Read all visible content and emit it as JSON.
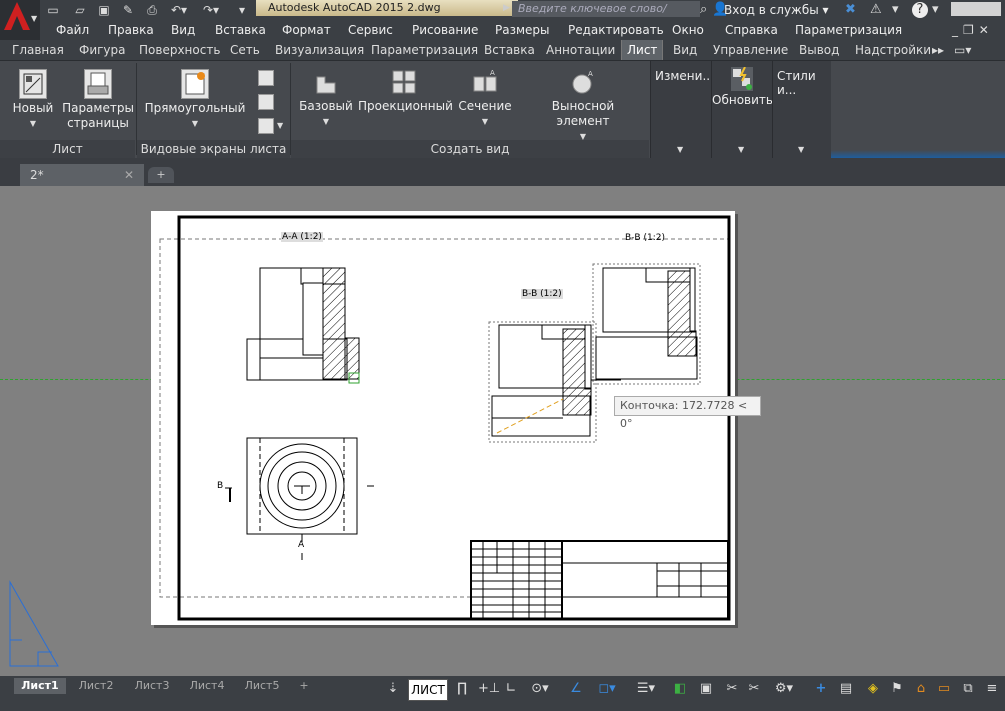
{
  "title_bar": {
    "app_title": "Autodesk AutoCAD 2015      2.dwg",
    "search_placeholder": "Введите ключевое слово/фразу",
    "login_label": "Вход в службы"
  },
  "menu_bar": [
    "Файл",
    "Правка",
    "Вид",
    "Вставка",
    "Формат",
    "Сервис",
    "Рисование",
    "Размеры",
    "Редактировать",
    "Окно",
    "Справка",
    "Параметризация"
  ],
  "ribbon_tabs": [
    "Главная",
    "Фигура",
    "Поверхность",
    "Сеть",
    "Визуализация",
    "Параметризация",
    "Вставка",
    "Аннотации",
    "Лист",
    "Вид",
    "Управление",
    "Вывод",
    "Надстройки"
  ],
  "ribbon": {
    "panels": [
      {
        "title": "Лист",
        "buttons": [
          "Новый",
          "Параметры страницы"
        ]
      },
      {
        "title": "Видовые экраны листа",
        "buttons": [
          "Прямоугольный"
        ]
      },
      {
        "title": "Создать вид",
        "buttons": [
          "Базовый",
          "Проекционный",
          "Сечение",
          "Выносной элемент"
        ]
      }
    ],
    "collapsed": [
      "Измени...",
      "Обновить",
      "Стили и..."
    ]
  },
  "file_tab": {
    "name": "2*"
  },
  "drawing": {
    "label_aa": "А-А (1:2)",
    "label_bb": "B-B (1:2)",
    "label_bb2": "В-В (1:2)",
    "arrow_b": "В",
    "arrow_a": "А",
    "tooltip": "Конточка: 172.7728 < 0°"
  },
  "layout_tabs": [
    "Лист1",
    "Лист2",
    "Лист3",
    "Лист4",
    "Лист5"
  ],
  "status_bar": {
    "space_button": "ЛИСТ"
  }
}
